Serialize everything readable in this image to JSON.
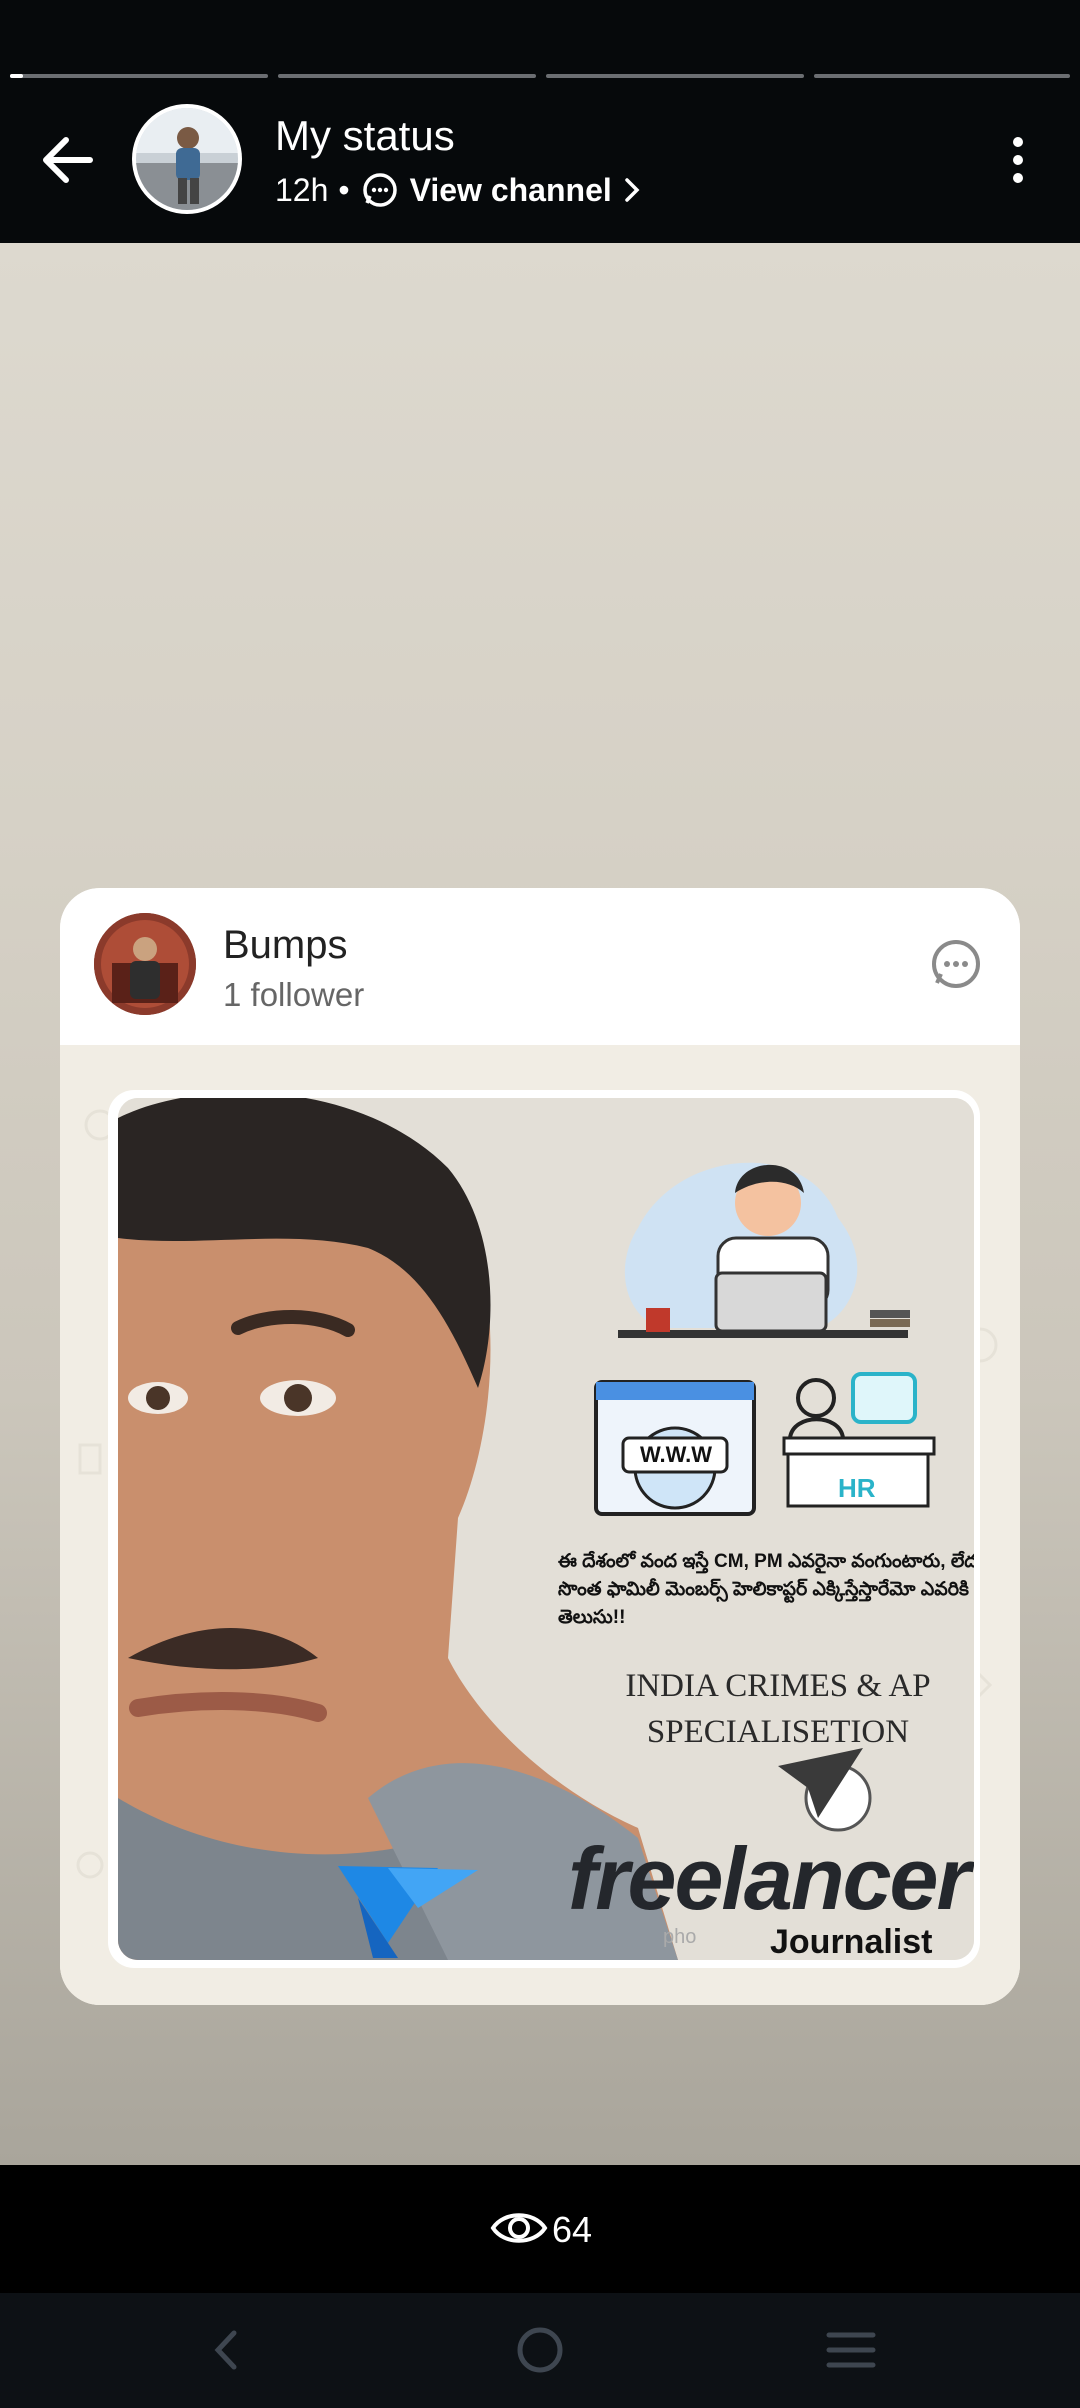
{
  "status": {
    "title": "My status",
    "time": "12h",
    "separator": "•",
    "view_channel": "View channel",
    "progress": [
      {
        "fill": 0.05
      },
      {
        "fill": 0
      },
      {
        "fill": 0
      },
      {
        "fill": 0
      }
    ]
  },
  "card": {
    "channel_name": "Bumps",
    "followers": "1 follower"
  },
  "poster": {
    "telugu_text": "ఈ దేశంలో వంద ఇస్తే CM, PM ఎవరైనా వంగుంటారు, లేదంటే సొంత ఫామిలీ మెంబర్స్ హెలికాప్టర్ ఎక్కిస్తేస్తారేమో ఎవరికి తెలుసు!!",
    "headline_line1": "INDIA CRIMES & AP",
    "headline_line2": "SPECIALISETION",
    "www_label": "W.W.W",
    "hr_label": "HR",
    "brand": "freelancer",
    "brand_sub": "Journalist",
    "watermark": "pho"
  },
  "views": {
    "count": "64"
  },
  "colors": {
    "brand_blue": "#1e88e5",
    "header_bg": "#06090b",
    "accent_teal": "#2ab3c9"
  }
}
